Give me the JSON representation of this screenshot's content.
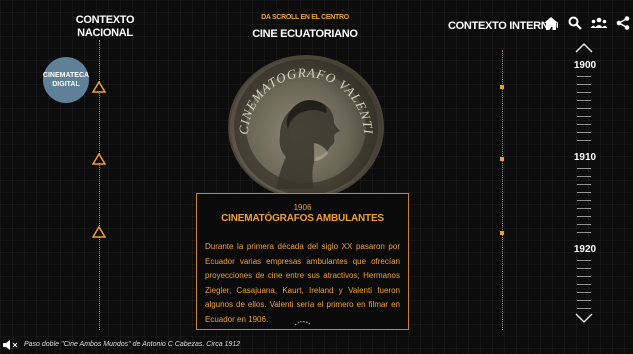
{
  "header": {
    "contexto_nacional_line1": "CONTEXTO",
    "contexto_nacional_line2": "NACIONAL",
    "scroll_hint": "DA SCROLL EN EL CENTRO",
    "center_title": "CINE ECUATORIANO",
    "contexto_internacional": "CONTEXTO INTERNACIONAL"
  },
  "toolbar": {
    "icons": [
      "home-icon",
      "search-icon",
      "people-icon",
      "share-icon"
    ]
  },
  "badge": {
    "line1": "CINEMATECA",
    "line2": "DIGITAL"
  },
  "timeline": {
    "years": [
      "1900",
      "1910",
      "1920"
    ]
  },
  "photo": {
    "engraved_text": "CINEMATOGRAFO VALENTI"
  },
  "card": {
    "year": "1906",
    "title": "CINEMATÓGRAFOS AMBULANTES",
    "body": "Durante la primera década del siglo XX pasaron por Ecuador varias empresas ambulantes que ofrecían proyecciones de cine entre sus atractivos; Hermanos Ziegler, Casajuana, Kaurt, Ireland y Valenti fueron algunos de ellos. Valenti sería el primero en filmar en Ecuador en 1906."
  },
  "caption": {
    "text": "Paso doble \"Cine Ambos Mundos\" de Antonio C Cabezas. Circa 1912"
  },
  "colors": {
    "accent": "#f0a030",
    "badge": "#5f8198",
    "background": "#0c0c0c"
  }
}
